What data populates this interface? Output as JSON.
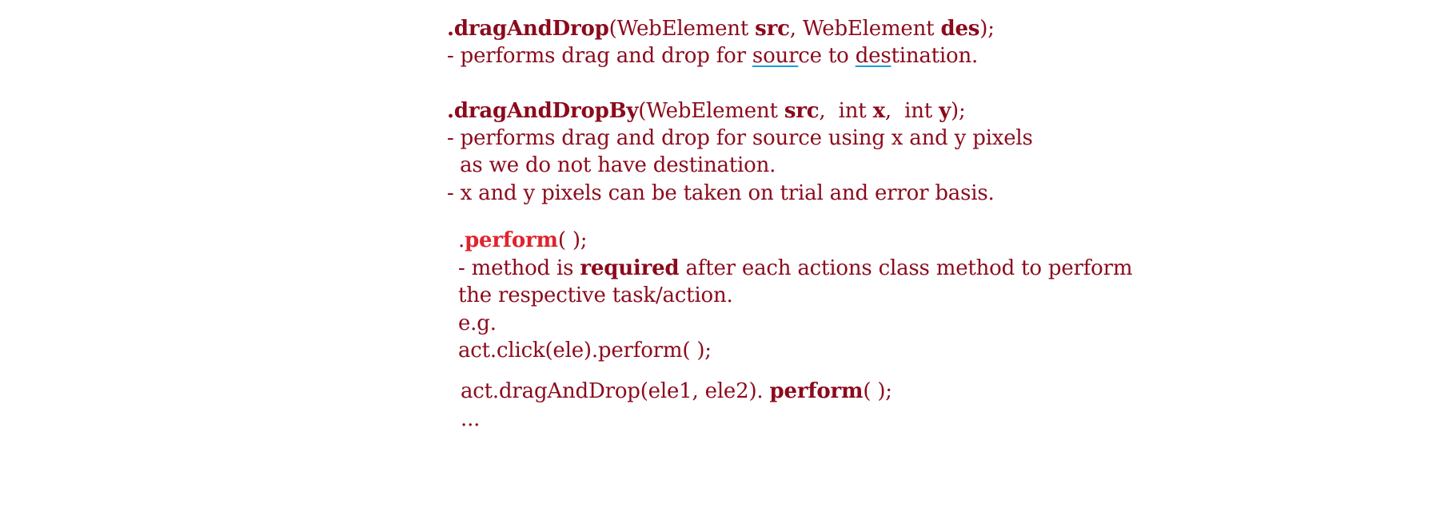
{
  "section1": {
    "sig_prefix": ".",
    "method_name": "dragAndDrop",
    "sig_open": "(WebElement ",
    "arg1": "src",
    "sig_mid": ", WebElement ",
    "arg2": "des",
    "sig_close": ");",
    "desc_pre": "- performs drag and drop for ",
    "desc_word1": "sour",
    "desc_mid1": "ce to ",
    "desc_word2": "des",
    "desc_end": "tination."
  },
  "section2": {
    "sig_prefix": ".",
    "method_name": "dragAndDropBy",
    "sig_open": "(WebElement ",
    "arg1": "src",
    "sig_mid1": ",  int ",
    "arg2": "x",
    "sig_mid2": ",  int ",
    "arg3": "y",
    "sig_close": ");",
    "desc_line1": "- performs drag and drop for source using x and y pixels",
    "desc_line2": "  as we do not have destination.",
    "desc_line3": "- x and y pixels can be taken on trial and error basis."
  },
  "section3": {
    "sig_prefix": ".",
    "method_name": "perform",
    "sig_close": "( );",
    "desc_pre": "- method is ",
    "desc_bold": "required",
    "desc_post": " after each actions class method to perform",
    "desc_line2": "the respective task/action.",
    "example_label": "e.g.",
    "example1": "act.click(ele).perform( );",
    "example2_pre": "act.dragAndDrop(ele1, ele2). ",
    "example2_bold": "perform",
    "example2_post": "( );",
    "ellipsis": "..."
  }
}
